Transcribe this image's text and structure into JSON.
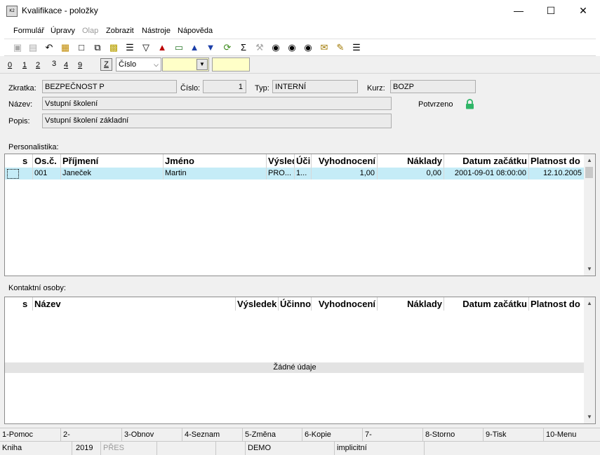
{
  "window": {
    "title": "Kvalifikace - položky",
    "app_icon_text": "K2"
  },
  "menu": [
    {
      "label": "Formulář",
      "enabled": true
    },
    {
      "label": "Úpravy",
      "enabled": true
    },
    {
      "label": "Olap",
      "enabled": false
    },
    {
      "label": "Zobrazit",
      "enabled": true
    },
    {
      "label": "Nástroje",
      "enabled": true
    },
    {
      "label": "Nápověda",
      "enabled": true
    }
  ],
  "toolbar_icons": [
    "save-icon",
    "save-close-icon",
    "undo-icon",
    "open-folder-icon",
    "new-document-icon",
    "copy-icon",
    "lock-icon",
    "book-icon",
    "filter-icon",
    "clear-filter-icon",
    "books-icon",
    "arrow-up-icon",
    "arrow-down-icon",
    "refresh-icon",
    "sum-icon",
    "tools-icon",
    "find-icon",
    "find-next-icon",
    "binoculars-icon",
    "mail-icon",
    "notes-icon",
    "menu-icon"
  ],
  "tabs": [
    {
      "label": "0",
      "active": false
    },
    {
      "label": "1",
      "active": false
    },
    {
      "label": "2",
      "active": false
    },
    {
      "label": "3",
      "active": true
    },
    {
      "label": "4",
      "active": false
    },
    {
      "label": "9",
      "active": false
    }
  ],
  "sort": {
    "z_label": "Z",
    "selected": "Číslo"
  },
  "form": {
    "zkratka_label": "Zkratka:",
    "zkratka": "BEZPEČNOST P",
    "cislo_label": "Číslo:",
    "cislo": "1",
    "typ_label": "Typ:",
    "typ": "INTERNÍ",
    "kurz_label": "Kurz:",
    "kurz": "BOZP",
    "nazev_label": "Název:",
    "nazev": "Vstupní školení",
    "potvrzeno_label": "Potvrzeno",
    "popis_label": "Popis:",
    "popis": "Vstupní školení základní"
  },
  "personalistika": {
    "label": "Personalistika:",
    "columns": [
      "s",
      "Os.č.",
      "Příjmení",
      "Jméno",
      "Výsledek",
      "Účinnost",
      "Vyhodnocení",
      "Náklady",
      "Datum začátku",
      "Platnost do"
    ],
    "rows": [
      {
        "s": "",
        "osc": "001",
        "prijmeni": "Janeček",
        "jmeno": "Martin",
        "vysledek": "PRO...",
        "ucinnost": "1...",
        "vyhodnoceni": "1,00",
        "naklady": "0,00",
        "datum": "2001-09-01 08:00:00",
        "platnost": "12.10.2005"
      }
    ]
  },
  "kontaktni": {
    "label": "Kontaktní osoby:",
    "columns": [
      "s",
      "Název",
      "Výsledek",
      "Účinnost",
      "Vyhodnocení",
      "Náklady",
      "Datum začátku",
      "Platnost do"
    ],
    "empty_text": "Žádné údaje"
  },
  "function_keys": [
    "1-Pomoc",
    "2-",
    "3-Obnov",
    "4-Seznam",
    "5-Změna",
    "6-Kopie",
    "7-",
    "8-Storno",
    "9-Tisk",
    "10-Menu"
  ],
  "status": {
    "kniha": "Kniha",
    "year": "2019",
    "mode": "PŘES",
    "db": "DEMO",
    "profile": "implicitní"
  },
  "colors": {
    "selected_row": "#c5ecf7",
    "input_highlight": "#ffffc8",
    "lock_green": "#2fb567"
  }
}
